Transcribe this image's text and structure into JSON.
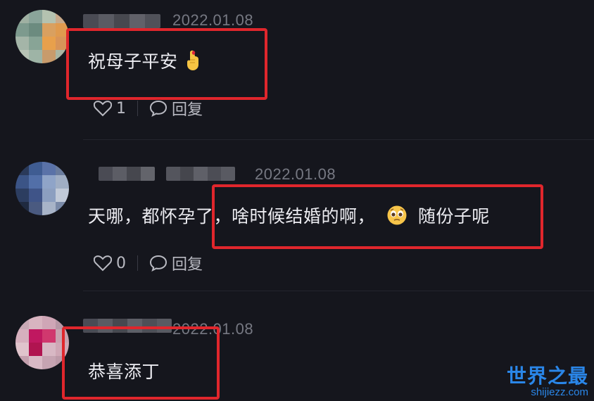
{
  "comments": [
    {
      "date": "2022.01.08",
      "text": "祝母子平安",
      "emoji": "pinky-promise-hand-icon",
      "likes": "1",
      "reply_label": "回复"
    },
    {
      "date": "2022.01.08",
      "text": "天哪，都怀孕了，啥时候结婚的啊，",
      "emoji": "pleading-face-icon",
      "text_after": "随份子呢",
      "likes": "0",
      "reply_label": "回复"
    },
    {
      "date": "2022.01.08",
      "text": "恭喜添丁"
    }
  ],
  "watermark": {
    "title": "世界之最",
    "domain": "shijiezz.com"
  },
  "colors": {
    "background": "#15161d",
    "highlight_box": "#e0262c",
    "date_text": "#767882",
    "watermark": "#2a86e8"
  }
}
